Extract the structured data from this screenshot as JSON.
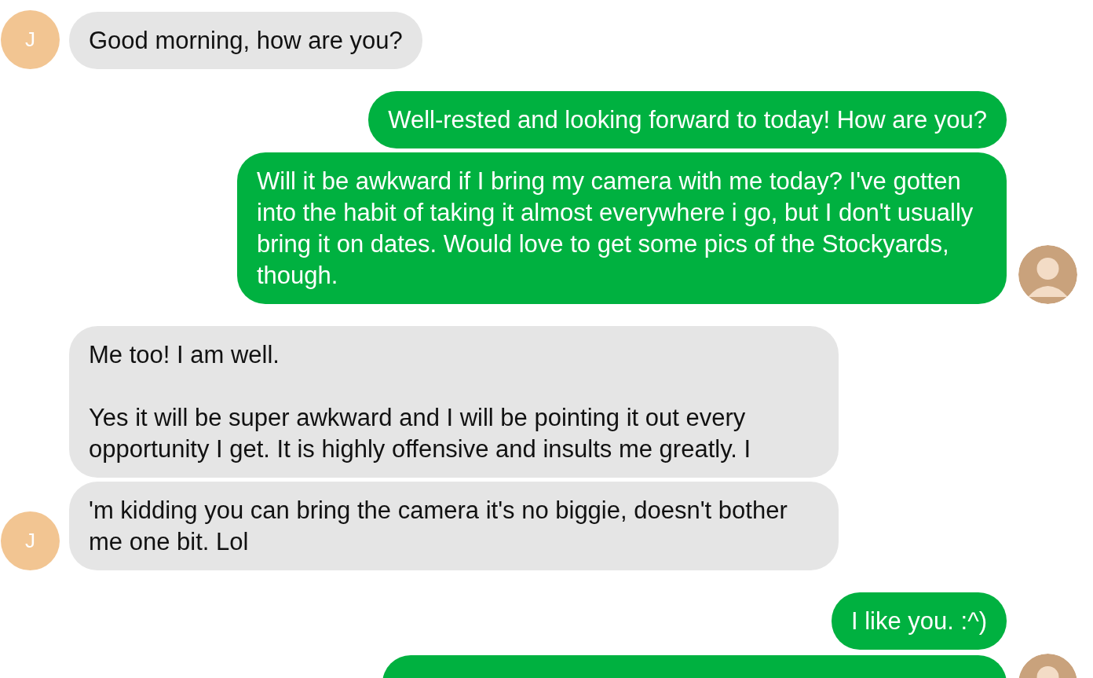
{
  "messages": [
    {
      "kind": "received",
      "text": "Good morning, how are you?",
      "avatar": {
        "kind": "letter",
        "letter": "J"
      }
    },
    {
      "kind": "sent",
      "text": "Well-rested and looking forward to today! How are you?"
    },
    {
      "kind": "sent",
      "text": "Will it be awkward if I bring my camera with me today? I've gotten into the habit of taking it almost everywhere i go, but I don't usually bring it on dates. Would love to get some pics of the Stockyards, though.",
      "avatar": {
        "kind": "photo"
      }
    },
    {
      "kind": "received",
      "text": "Me too! I am well.\n\nYes it will be super awkward and I will be pointing it out every opportunity I get. It is highly offensive and insults me greatly. I"
    },
    {
      "kind": "received",
      "text": "'m kidding you can bring the camera it's no biggie, doesn't bother me one bit. Lol",
      "avatar": {
        "kind": "letter",
        "letter": "J"
      }
    },
    {
      "kind": "sent",
      "text": "I like you. :^)"
    },
    {
      "kind": "sent",
      "avatar": {
        "kind": "photo"
      }
    }
  ]
}
